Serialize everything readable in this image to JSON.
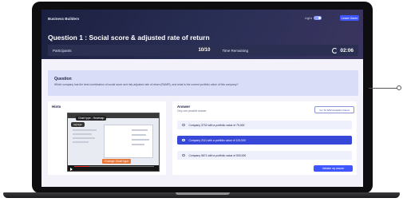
{
  "app": {
    "brand": "Business Builders"
  },
  "header": {
    "toggle_label": "Light",
    "leave_label": "Leave Game",
    "question_title": "Question 1 : Social score & adjusted rate of return"
  },
  "stats": {
    "participants_label": "Participants",
    "participants_value": "10/10",
    "time_label": "Time Remaining",
    "time_value": "02:06"
  },
  "question": {
    "label": "Question",
    "text": "Which company has the best combination of social score and risk-adjusted rate of return (RAMR), and what is the current portfolio value of this company?"
  },
  "hints": {
    "label": "Hints",
    "video_tag_1": "Chart type - Heatmap",
    "video_tag_2": "Change Chart type",
    "video_tag_3": "Highlight"
  },
  "answer": {
    "label": "Answer",
    "subtitle": "Only one possible answer.",
    "goto_label": "Go To SAP Analytics Cloud",
    "options": [
      {
        "text": "Company 3732 with a portfolio value of 75,000",
        "selected": false
      },
      {
        "text": "Company 2111 with a portfolio value of 100,000",
        "selected": true
      },
      {
        "text": "Company 5671 with a portfolio value of 500,000",
        "selected": false
      }
    ],
    "validate_label": "Validate my answer"
  },
  "colors": {
    "accent": "#3d56ff",
    "selected": "#3747d8",
    "header": "#1c2040"
  }
}
